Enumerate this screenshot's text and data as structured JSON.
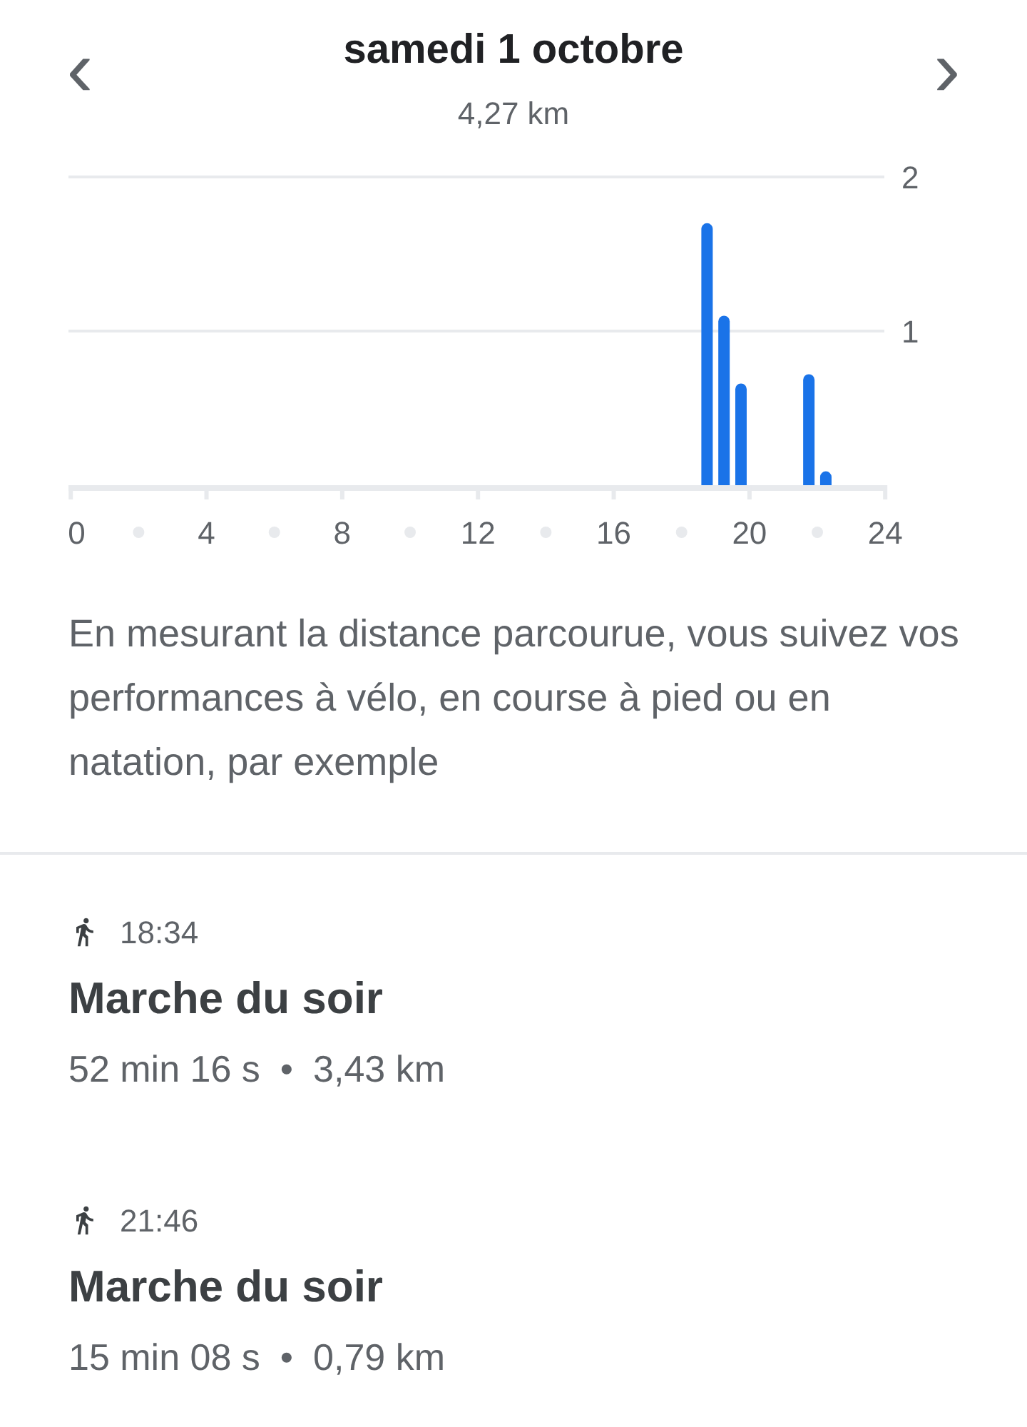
{
  "header": {
    "prev": "‹",
    "title": "samedi 1 octobre",
    "distance": "4,27 km",
    "next": "›"
  },
  "chart": {
    "chart_data": {
      "type": "bar",
      "x": [
        18.75,
        19.25,
        19.75,
        21.75,
        22.25
      ],
      "series": [
        {
          "color": "#1a73e8",
          "values": [
            1.7,
            1.1,
            0.66,
            0.72,
            0.09
          ]
        }
      ],
      "xlim": [
        0,
        24
      ],
      "ylim": [
        0,
        2
      ],
      "xticks": [
        0,
        4,
        8,
        12,
        16,
        20,
        24
      ],
      "yticks": [
        1,
        2
      ]
    }
  },
  "description": "En mesurant la distance parcourue, vous suivez vos performances à vélo, en course à pied ou en natation, par exemple",
  "activities": [
    {
      "kind": "walk",
      "time": "18:34",
      "title": "Marche du soir",
      "duration": "52 min 16 s",
      "separator": "•",
      "distance": "3,43 km"
    },
    {
      "kind": "walk",
      "time": "21:46",
      "title": "Marche du soir",
      "duration": "15 min 08 s",
      "separator": "•",
      "distance": "0,79 km"
    }
  ]
}
